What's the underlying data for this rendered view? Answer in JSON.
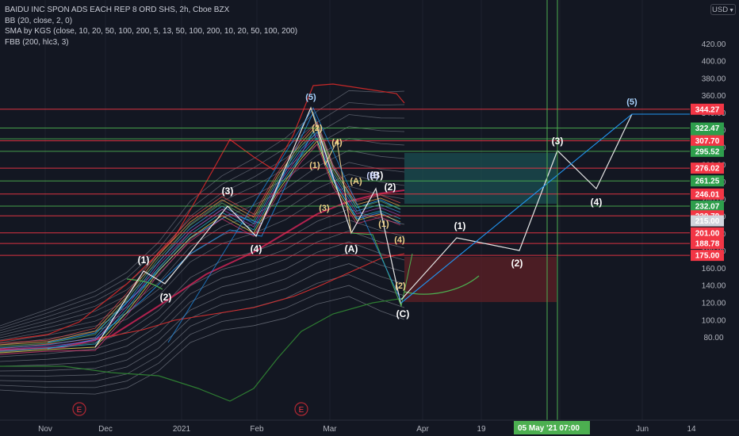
{
  "legend": {
    "symbol": "BAIDU INC SPON ADS EACH REP 8 ORD SHS, 2h, Cboe BZX",
    "bb": "BB (20, close, 2, 0)",
    "sma": "SMA by KGS (close, 10, 20, 50, 100, 200, 5, 13, 50, 100, 200, 10, 20, 50, 100, 200)",
    "fbb": "FBB (200, hlc3, 3)"
  },
  "currency_button": "USD",
  "colors": {
    "background": "#131722",
    "red_level": "#f23645",
    "green_level": "#4caf50",
    "band_red": "#c62828",
    "band_green": "#2e7d32",
    "bb_blue": "#2196f3",
    "teal_box": "#1b4f52",
    "red_box": "#5a1f25",
    "wave_line": "#e6e6e6",
    "projection_blue": "#2196f3"
  },
  "chart_data": {
    "type": "line",
    "title": "BAIDU INC SPON ADS EACH REP 8 ORD SHS, 2h, Cboe BZX",
    "y_axis": {
      "ticks": [
        80,
        100,
        120,
        140,
        160,
        180,
        200,
        220,
        240,
        260,
        280,
        300,
        320,
        340,
        360,
        380,
        400,
        420
      ],
      "ylim": [
        70,
        430
      ]
    },
    "x_axis": {
      "ticks": [
        "Nov",
        "Dec",
        "2021",
        "Feb",
        "Mar",
        "Apr",
        "19",
        "May",
        "Jun",
        "14"
      ],
      "cursor_label": "05 May '21  07:00"
    },
    "price_levels": [
      {
        "value": 344.27,
        "label": "344.27",
        "color": "red"
      },
      {
        "value": 322.47,
        "label": "322.47",
        "color": "green"
      },
      {
        "value": 310.0,
        "label": "310.00",
        "color": "green"
      },
      {
        "value": 307.7,
        "label": "307.70",
        "color": "red"
      },
      {
        "value": 295.52,
        "label": "295.52",
        "color": "green"
      },
      {
        "value": 276.02,
        "label": "276.02",
        "color": "red"
      },
      {
        "value": 261.25,
        "label": "261.25",
        "color": "green"
      },
      {
        "value": 246.01,
        "label": "246.01",
        "color": "red"
      },
      {
        "value": 232.07,
        "label": "232.07",
        "color": "green"
      },
      {
        "value": 220.79,
        "label": "220.79",
        "color": "red"
      },
      {
        "value": 215.0,
        "label": "215.00",
        "color": "gray"
      },
      {
        "value": 201.0,
        "label": "201.00",
        "color": "red"
      },
      {
        "value": 188.78,
        "label": "188.78",
        "color": "red"
      },
      {
        "value": 175.0,
        "label": "175.00",
        "color": "red"
      }
    ],
    "price_series": {
      "name": "",
      "points": [
        [
          "Oct 20",
          132
        ],
        [
          "Oct 27",
          136
        ],
        [
          "Nov 3",
          134
        ],
        [
          "Nov 10",
          140
        ],
        [
          "Nov 17",
          137
        ],
        [
          "Nov 24",
          142
        ],
        [
          "Dec 1",
          148
        ],
        [
          "Dec 8",
          158
        ],
        [
          "Dec 12",
          178
        ],
        [
          "Dec 16",
          196
        ],
        [
          "Dec 20",
          186
        ],
        [
          "Dec 24",
          198
        ],
        [
          "Dec 31",
          214
        ],
        [
          "Jan 5",
          222
        ],
        [
          "Jan 10",
          232
        ],
        [
          "Jan 15",
          246
        ],
        [
          "Jan 19",
          254
        ],
        [
          "Jan 24",
          258
        ],
        [
          "Jan 28",
          240
        ],
        [
          "Feb 2",
          236
        ],
        [
          "Feb 7",
          256
        ],
        [
          "Feb 11",
          286
        ],
        [
          "Feb 16",
          312
        ],
        [
          "Feb 19",
          350
        ],
        [
          "Feb 22",
          320
        ],
        [
          "Feb 24",
          300
        ],
        [
          "Feb 26",
          282
        ],
        [
          "Mar 2",
          256
        ],
        [
          "Mar 5",
          236
        ],
        [
          "Mar 8",
          262
        ],
        [
          "Mar 11",
          282
        ],
        [
          "Mar 15",
          272
        ],
        [
          "Mar 18",
          268
        ],
        [
          "Mar 21",
          256
        ],
        [
          "Mar 24",
          198
        ],
        [
          "Mar 26",
          176
        ],
        [
          "Mar 28",
          192
        ]
      ]
    },
    "wave_labels": [
      "(1)",
      "(2)",
      "(3)",
      "(4)",
      "(5)",
      "(2)",
      "(4)",
      "(1)",
      "(3)",
      "(A)",
      "(B)",
      "(B)",
      "(A)",
      "(1)",
      "(2)",
      "(4)",
      "(2)",
      "(C)",
      "(1)",
      "(2)",
      "(3)",
      "(4)",
      "(5)"
    ],
    "earnings_markers": [
      "E",
      "E"
    ],
    "projection": {
      "points": [
        [
          "Mar 28",
          176
        ],
        [
          "Apr 10",
          240
        ],
        [
          "Apr 30",
          224
        ],
        [
          "May 7",
          306
        ],
        [
          "May 22",
          276
        ],
        [
          "Jun 2",
          344
        ]
      ]
    }
  }
}
